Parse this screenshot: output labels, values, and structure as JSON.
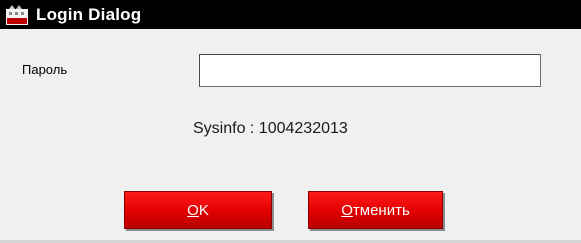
{
  "window": {
    "title": "Login Dialog",
    "icon": "app-logo-icon"
  },
  "form": {
    "password_label": "Пароль",
    "password_value": "",
    "password_placeholder": ""
  },
  "info": {
    "sysinfo": "Sysinfo : 1004232013"
  },
  "buttons": {
    "ok": {
      "mnemonic": "O",
      "rest": "K"
    },
    "cancel": {
      "mnemonic": "О",
      "rest": "тменить"
    }
  },
  "colors": {
    "titlebar": "#000000",
    "button": "#e00000",
    "background": "#f0f0f0"
  }
}
